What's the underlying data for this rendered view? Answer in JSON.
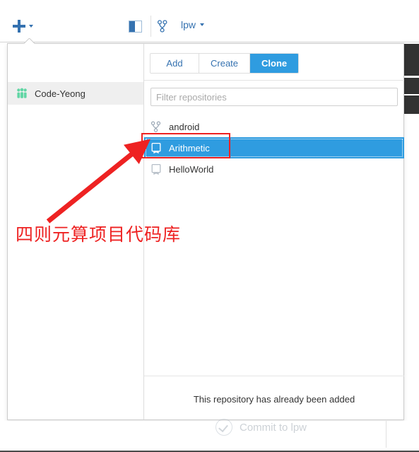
{
  "toolbar": {
    "add_icon": "plus-icon",
    "add_caret": "chevron-down-icon",
    "panel_toggle_icon": "panel-toggle-icon",
    "branch_icon": "branch-icon",
    "branch_label": "lpw",
    "branch_caret": "chevron-down-icon"
  },
  "popup": {
    "sidebar": {
      "accounts": [
        {
          "label": "Code-Yeong",
          "icon": "account-group-icon",
          "selected": true
        }
      ]
    },
    "tabs": [
      {
        "label": "Add",
        "active": false
      },
      {
        "label": "Create",
        "active": false
      },
      {
        "label": "Clone",
        "active": true
      }
    ],
    "filter": {
      "placeholder": "Filter repositories",
      "value": ""
    },
    "repositories": [
      {
        "name": "android",
        "icon": "branch-icon",
        "selected": false
      },
      {
        "name": "Arithmetic",
        "icon": "repository-icon",
        "selected": true
      },
      {
        "name": "HelloWorld",
        "icon": "repository-icon",
        "selected": false
      }
    ],
    "footer_message": "This repository has already been added"
  },
  "commit": {
    "icon": "check-circle-icon",
    "label": "Commit to lpw"
  },
  "annotation": {
    "text": "四则元算项目代码库",
    "color": "#ee2222",
    "arrow_icon": "arrow-pointer-icon",
    "highlight_icon": "highlight-box"
  },
  "colors": {
    "accent_blue": "#2f9ce0",
    "link_blue": "#3572b0",
    "annotation_red": "#ee2222",
    "dark_panel": "#323232",
    "account_row_bg": "#efefef"
  }
}
